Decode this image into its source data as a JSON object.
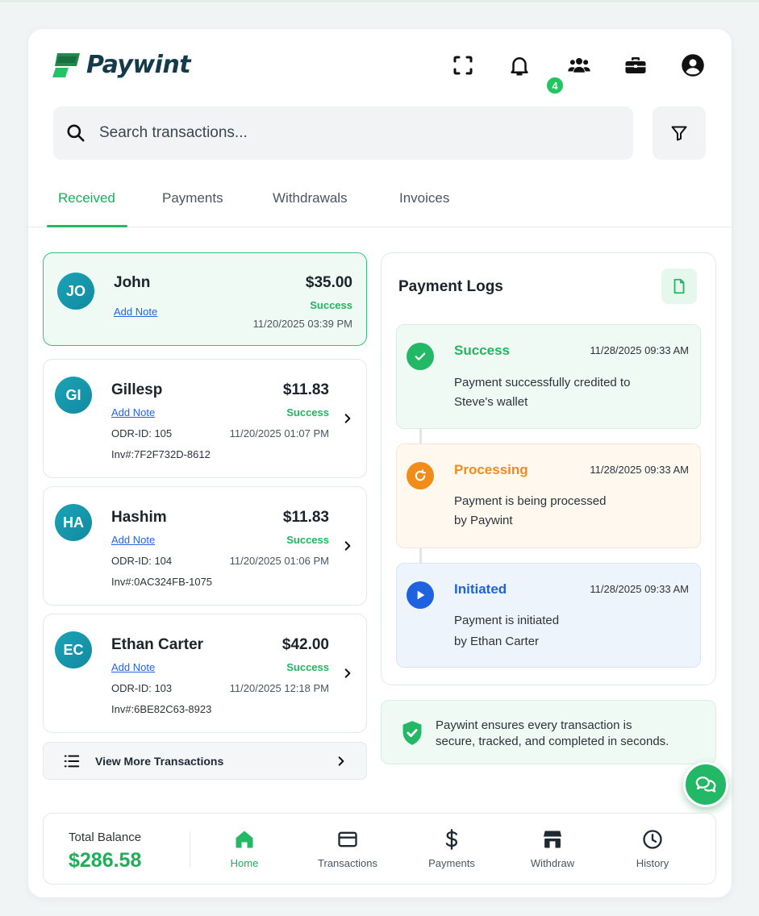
{
  "app": {
    "name": "Paywint"
  },
  "header": {
    "notification_count": "4",
    "icons": [
      "scan-icon",
      "bell-icon",
      "users-icon",
      "briefcase-icon",
      "profile-icon"
    ]
  },
  "search": {
    "placeholder": "Search transactions..."
  },
  "tabs": [
    {
      "label": "Received",
      "active": true
    },
    {
      "label": "Payments",
      "active": false
    },
    {
      "label": "Withdrawals",
      "active": false
    },
    {
      "label": "Invoices",
      "active": false
    }
  ],
  "transactions": [
    {
      "initials": "JO",
      "name": "John",
      "add_note": "Add Note",
      "amount": "$35.00",
      "status": "Success",
      "date": "11/20/2025 03:39 PM",
      "selected": true
    },
    {
      "initials": "GI",
      "name": "Gillesp",
      "add_note": "Add Note",
      "amount": "$11.83",
      "status": "Success",
      "date": "11/20/2025 01:07 PM",
      "odr": "ODR-ID:  105",
      "inv": "Inv#:7F2F732D-8612"
    },
    {
      "initials": "HA",
      "name": "Hashim",
      "add_note": "Add Note",
      "amount": "$11.83",
      "status": "Success",
      "date": "11/20/2025 01:06 PM",
      "odr": "ODR-ID:  104",
      "inv": "Inv#:0AC324FB-1075"
    },
    {
      "initials": "EC",
      "name": "Ethan Carter",
      "add_note": "Add Note",
      "amount": "$42.00",
      "status": "Success",
      "date": "11/20/2025 12:18 PM",
      "odr": "ODR-ID:  103",
      "inv": "Inv#:6BE82C63-8923"
    }
  ],
  "view_more": {
    "label": "View More Transactions"
  },
  "payment_logs": {
    "title": "Payment Logs",
    "items": [
      {
        "status": "Success",
        "time": "11/28/2025 09:33 AM",
        "desc_line1": "Payment successfully credited to",
        "desc_line2": "Steve's wallet",
        "color": "#22b55e"
      },
      {
        "status": "Processing",
        "time": "11/28/2025 09:33 AM",
        "desc_line1": "Payment is being processed",
        "desc_line2": "by Paywint",
        "color": "#f08c1a"
      },
      {
        "status": "Initiated",
        "time": "11/28/2025 09:33 AM",
        "desc_line1": "Payment is initiated",
        "desc_line2": "by Ethan Carter",
        "color": "#1f62e0"
      }
    ]
  },
  "secure_note": {
    "line1": "Paywint ensures every transaction is",
    "line2": "secure, tracked, and completed in seconds."
  },
  "bottom_nav": {
    "balance_label": "Total Balance",
    "balance_value": "$286.58",
    "items": [
      {
        "label": "Home",
        "icon": "home-icon",
        "active": true
      },
      {
        "label": "Transactions",
        "icon": "card-icon",
        "active": false
      },
      {
        "label": "Payments",
        "icon": "dollar-icon",
        "active": false
      },
      {
        "label": "Withdraw",
        "icon": "store-icon",
        "active": false
      },
      {
        "label": "History",
        "icon": "clock-icon",
        "active": false
      }
    ]
  },
  "colors": {
    "brand": "#22b866",
    "brand_dark": "#143b4a",
    "link": "#2563eb"
  }
}
